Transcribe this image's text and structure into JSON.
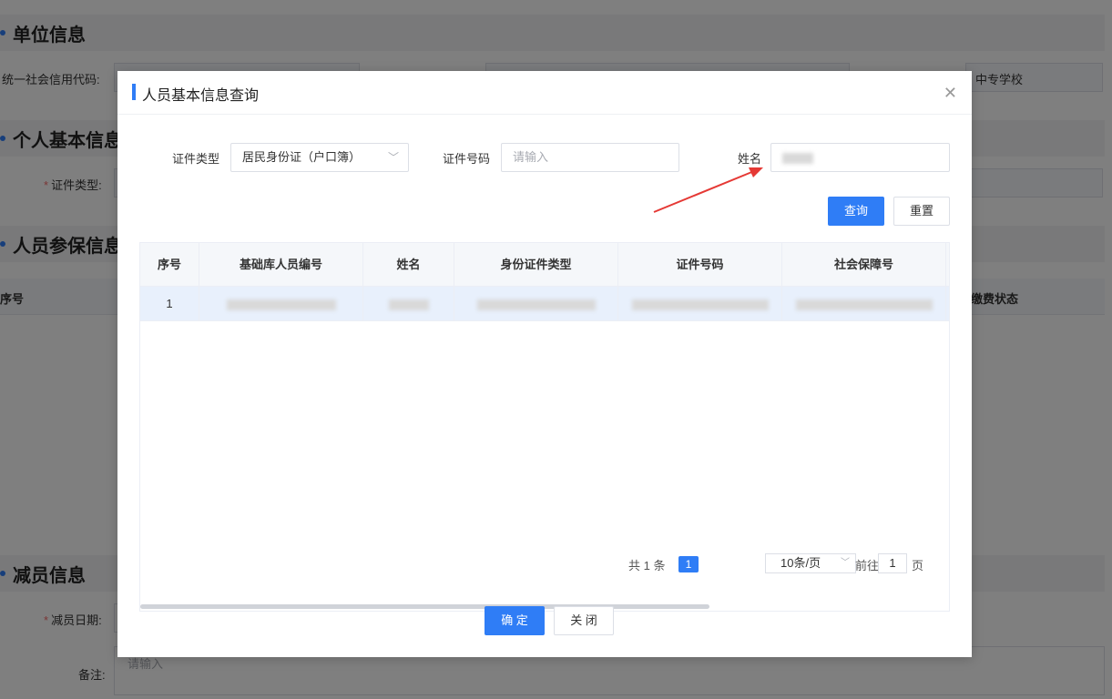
{
  "background": {
    "unit_section_title": "单位信息",
    "credit_code_label": "统一社会信用代码:",
    "school_value": "中专学校",
    "person_section_title": "个人基本信息",
    "id_type_label": "证件类型:",
    "insured_section_title": "人员参保信息",
    "col_index": "序号",
    "col_payment_status": "缴费状态",
    "reduction_section_title": "减员信息",
    "reduction_date_label": "减员日期:",
    "remark_label": "备注:",
    "remark_placeholder": "请输入"
  },
  "dialog": {
    "title": "人员基本信息查询",
    "close_icon": "close-icon",
    "form": {
      "id_type_label": "证件类型",
      "id_type_value": "居民身份证（户口簿）",
      "id_number_label": "证件号码",
      "id_number_placeholder": "请输入",
      "name_label": "姓名"
    },
    "query_button": "查询",
    "reset_button": "重置",
    "table": {
      "columns": [
        "序号",
        "基础库人员编号",
        "姓名",
        "身份证件类型",
        "证件号码",
        "社会保障号"
      ],
      "rows": [
        {
          "index": "1"
        }
      ]
    },
    "pagination": {
      "total": "共 1 条",
      "current_page": "1",
      "page_size": "10条/页",
      "goto_prefix": "前往",
      "goto_value": "1",
      "goto_suffix": "页"
    },
    "confirm_button": "确 定",
    "close_button": "关 闭"
  },
  "colors": {
    "primary": "#2f7df6",
    "annotation_arrow": "#e53935"
  }
}
